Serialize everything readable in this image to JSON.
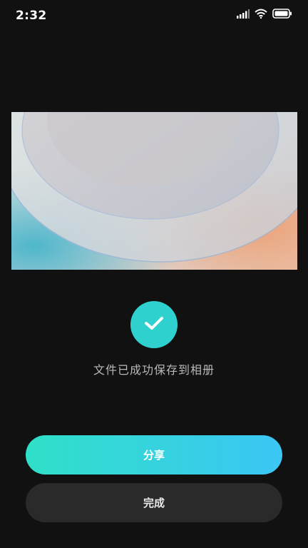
{
  "status_bar": {
    "time": "2:32",
    "icons": [
      "signal-icon",
      "wifi-icon",
      "battery-icon"
    ]
  },
  "preview": {
    "description_icon": "wallpaper-preview"
  },
  "success": {
    "icon": "checkmark-icon",
    "message": "文件已成功保存到相册"
  },
  "actions": {
    "share_label": "分享",
    "done_label": "完成"
  },
  "colors": {
    "background": "#111111",
    "accent_start": "#2fe0c8",
    "accent_end": "#3cc6f5",
    "check_bg": "#2fd1cf",
    "secondary_button": "#2a2a2a"
  }
}
